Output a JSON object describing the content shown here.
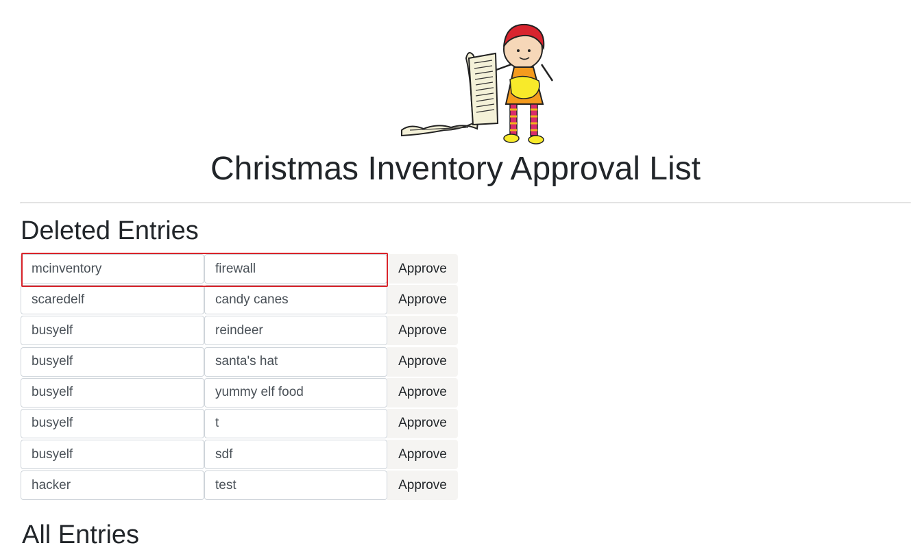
{
  "header": {
    "title": "Christmas Inventory Approval List",
    "mascot": "elf-with-list-illustration"
  },
  "deleted": {
    "heading": "Deleted Entries",
    "approve_label": "Approve",
    "rows": [
      {
        "user": "mcinventory",
        "item": "firewall"
      },
      {
        "user": "scaredelf",
        "item": "candy canes"
      },
      {
        "user": "busyelf",
        "item": "reindeer"
      },
      {
        "user": "busyelf",
        "item": "santa's hat"
      },
      {
        "user": "busyelf",
        "item": "yummy elf food"
      },
      {
        "user": "busyelf",
        "item": "t"
      },
      {
        "user": "busyelf",
        "item": "sdf"
      },
      {
        "user": "hacker",
        "item": "test"
      }
    ]
  },
  "all_entries": {
    "heading": "All Entries"
  },
  "colors": {
    "highlight": "#d9232a",
    "approve_bg": "#f5f4f2"
  }
}
